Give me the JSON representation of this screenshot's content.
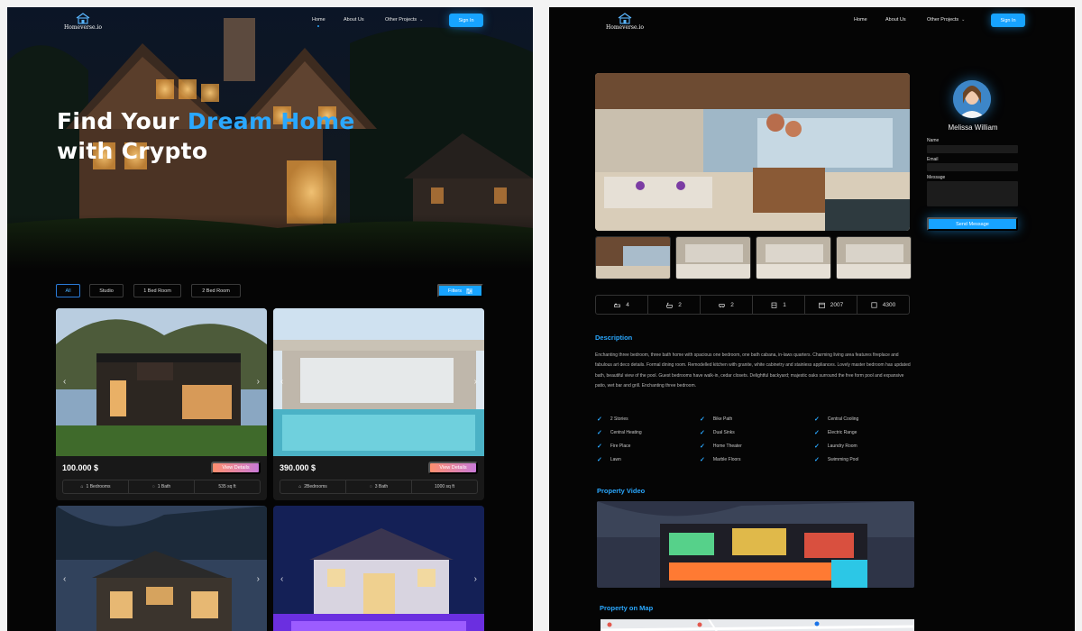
{
  "brand": {
    "name": "Homeverse.io"
  },
  "nav": {
    "items": [
      {
        "label": "Home"
      },
      {
        "label": "About Us"
      },
      {
        "label": "Other Projects"
      }
    ],
    "sign_in": "Sign In"
  },
  "hero": {
    "title_part1": "Find Your ",
    "title_highlight": "Dream Home",
    "title_part2": "with Crypto"
  },
  "filters": {
    "chips": [
      {
        "label": "All"
      },
      {
        "label": "Studio"
      },
      {
        "label": "1 Bed Room"
      },
      {
        "label": "2 Bed Room"
      }
    ],
    "filters_label": "Filters"
  },
  "listings": [
    {
      "price": "100.000 $",
      "button": "View Details",
      "stats": [
        "1 Bedrooms",
        "1 Bath",
        "535 sq ft"
      ]
    },
    {
      "price": "390.000 $",
      "button": "View Details",
      "stats": [
        "2Bedrooms",
        "3 Bath",
        "1000 sq ft"
      ]
    }
  ],
  "property": {
    "specs": [
      {
        "icon": "bed-icon",
        "value": "4"
      },
      {
        "icon": "bath-icon",
        "value": "2"
      },
      {
        "icon": "car-icon",
        "value": "2"
      },
      {
        "icon": "floor-icon",
        "value": "1"
      },
      {
        "icon": "calendar-icon",
        "value": "2007"
      },
      {
        "icon": "area-icon",
        "value": "4300"
      }
    ],
    "description_title": "Description",
    "description": "Enchanting three bedroom, three bath home with spacious one bedroom, one bath cabana, in-laws quarters. Charming living area features fireplace and fabulous art deco details. Formal dining room. Remodelled kitchen with granite, white cabinetry and stainless appliances. Lovely master bedroom has updated bath, beautiful view of the pool. Guest bedrooms have walk-in, cedar closets. Delightful backyard; majestic oaks surround the free form pool and expansive patio, wet bar and grill. Enchanting three bedroom.",
    "features": [
      "2 Stories",
      "Bike Path",
      "Central Cooling",
      "Central Heating",
      "Dual Sinks",
      "Electric Range",
      "Fire Place",
      "Home Theater",
      "Laundry Room",
      "Lawn",
      "Marble Floors",
      "Swimming Pool"
    ],
    "video_title": "Property Video",
    "map_title": "Property on Map"
  },
  "contact": {
    "agent_name": "Melissa William",
    "name_label": "Name",
    "email_label": "Email",
    "message_label": "Message",
    "send_label": "Send Message"
  },
  "colors": {
    "accent": "#17a3ff",
    "background": "#050505",
    "card": "#181818"
  }
}
